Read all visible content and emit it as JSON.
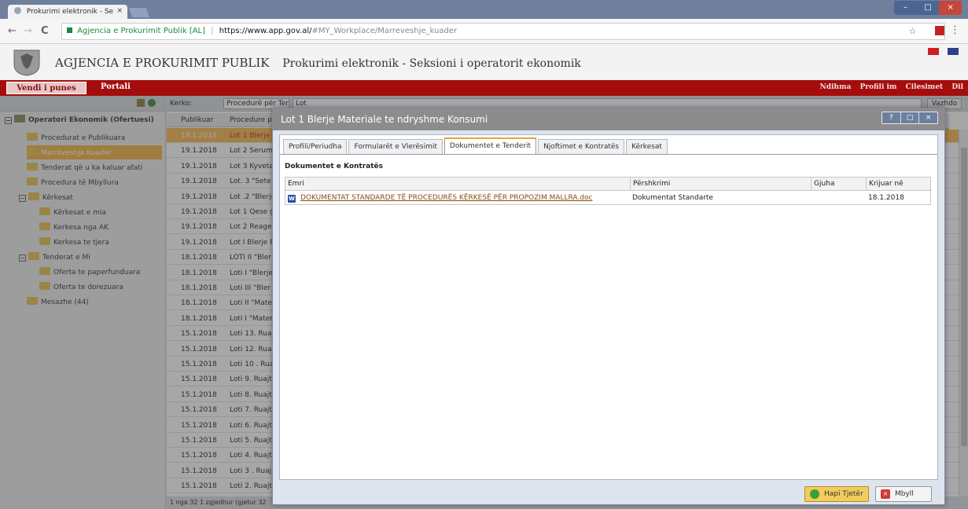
{
  "browser": {
    "tab_title": "Prokurimi elektronik - Se",
    "tab_close": "×",
    "win_min": "–",
    "win_max": "□",
    "win_close": "×",
    "back": "←",
    "forward": "→",
    "reload": "C",
    "secure_label": "Agjencia e Prokurimit Publik [AL]",
    "url_separator": "|",
    "url_host": "https://www.app.gov.al/",
    "url_path": "#MY_Workplace/Marreveshje_kuader",
    "star": "☆",
    "menu": "⋮"
  },
  "app": {
    "title": "AGJENCIA E PROKURIMIT PUBLIK",
    "subtitle": "Prokurimi elektronik - Seksioni i operatorit ekonomik"
  },
  "nav": {
    "active": "Vendi i punes",
    "portal": "Portali",
    "right_items": [
      "Ndihma",
      "Profili im",
      "Cilesimet",
      "Dil"
    ]
  },
  "tree": {
    "root": "Operatori Ekonomik (Ofertuesi)",
    "items": [
      {
        "label": "Procedurat e Publikuara"
      },
      {
        "label": "Marrëveshja Kuadër",
        "selected": true
      },
      {
        "label": "Tenderat që u ka kaluar afati"
      },
      {
        "label": "Procedura të Mbyllura"
      },
      {
        "label": "Kërkesat",
        "expand": "−"
      },
      {
        "label": "Kërkesat e mia"
      },
      {
        "label": "Kerkesa nga AK"
      },
      {
        "label": "Kerkesa te tjera"
      },
      {
        "label": "Tenderat e Mi",
        "expand": "−"
      },
      {
        "label": "Oferta te paperfunduara"
      },
      {
        "label": "Oferta te dorezuara"
      },
      {
        "label": "Mesazhe (44)"
      }
    ]
  },
  "grid": {
    "search_label": "Kerko:",
    "search_combo": "Procedurë për Tender",
    "search_value": "Lot",
    "search_button": "Vazhdo",
    "col_published": "Publikuar",
    "col_procedure": "Procedure pë",
    "rows": [
      {
        "date": "19.1.2018",
        "name": "Lot 1 Blerje",
        "selected": true
      },
      {
        "date": "19.1.2018",
        "name": "Lot 2 Serume"
      },
      {
        "date": "19.1.2018",
        "name": "Lot 3 Kyveta"
      },
      {
        "date": "19.1.2018",
        "name": "Lot. 3 \"Sete"
      },
      {
        "date": "19.1.2018",
        "name": "Lot .2 \"Blerje"
      },
      {
        "date": "19.1.2018",
        "name": "Lot 1 Qese g"
      },
      {
        "date": "19.1.2018",
        "name": "Lot 2 Reagen"
      },
      {
        "date": "19.1.2018",
        "name": "Lot I Blerje R"
      },
      {
        "date": "18.1.2018",
        "name": "LOTI II \"Bler"
      },
      {
        "date": "18.1.2018",
        "name": "Loti I \"Blerje"
      },
      {
        "date": "18.1.2018",
        "name": "Loti III \"Bler"
      },
      {
        "date": "18.1.2018",
        "name": "Loti II \"Mate"
      },
      {
        "date": "18.1.2018",
        "name": "Loti I \"Mater"
      },
      {
        "date": "15.1.2018",
        "name": "Loti 13. Ruaj"
      },
      {
        "date": "15.1.2018",
        "name": "Loti 12. Ruaj"
      },
      {
        "date": "15.1.2018",
        "name": "Loti 10 . Rua"
      },
      {
        "date": "15.1.2018",
        "name": "Loti 9. Ruajt"
      },
      {
        "date": "15.1.2018",
        "name": "Loti 8. Ruajt"
      },
      {
        "date": "15.1.2018",
        "name": "Loti 7. Ruajt"
      },
      {
        "date": "15.1.2018",
        "name": "Loti 6. Ruajt"
      },
      {
        "date": "15.1.2018",
        "name": "Loti 5. Ruajt"
      },
      {
        "date": "15.1.2018",
        "name": "Loti 4. Ruajt"
      },
      {
        "date": "15.1.2018",
        "name": "Loti 3 . Ruaj"
      },
      {
        "date": "15.1.2018",
        "name": "Loti 2. Ruajt"
      }
    ],
    "status": "1 nga 32 1 zgjedhur (gjetur 32"
  },
  "modal": {
    "title": "Lot 1 Blerje Materiale te ndryshme Konsumi",
    "tabs": [
      {
        "label": "Profili/Periudha"
      },
      {
        "label": "Formularët e Vlerësimit"
      },
      {
        "label": "Dokumentet e Tenderit",
        "active": true
      },
      {
        "label": "Njoftimet e Kontratës"
      },
      {
        "label": "Kërkesat"
      }
    ],
    "section": "Dokumentet e Kontratës",
    "columns": {
      "name": "Emri",
      "desc": "Përshkrimi",
      "lang": "Gjuha",
      "created": "Krijuar në"
    },
    "documents": [
      {
        "name": "DOKUMENTAT STANDARDE TË PROCEDURËS KËRKESË PËR PROPOZIM MALLRA.doc",
        "desc": "Dokumentat Standarte",
        "lang": "",
        "created": "18.1.2018"
      }
    ],
    "btn_next": "Hapi Tjetër",
    "btn_close": "Mbyll"
  }
}
